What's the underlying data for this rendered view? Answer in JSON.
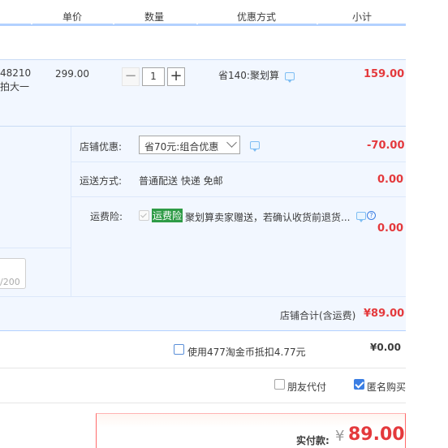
{
  "header": {
    "col_price": "单价",
    "col_qty": "数量",
    "col_promo": "优惠方式",
    "col_subtotal": "小计"
  },
  "item": {
    "id_fragment": "48210",
    "title_fragment": "拍大一",
    "price": "299.00",
    "quantity": "1",
    "promo": "省140:聚划算",
    "subtotal": "159.00"
  },
  "shop": {
    "discount_label": "店铺优惠:",
    "discount_selected": "省70元:组合优惠",
    "discount_amount": "-70.00",
    "shipping_label": "运送方式:",
    "shipping_value": "普通配送 快递 免邮",
    "shipping_amount": "0.00",
    "insurance_label": "运费险:",
    "insurance_tag": "运费险",
    "insurance_text": "聚划算卖家赠送，若确认收货前退货...",
    "insurance_amount": "0.00",
    "memo_counter": "/200",
    "total_label": "店铺合计(含运费)",
    "total_amount": "¥89.00"
  },
  "coin": {
    "label": "使用477淘金币抵扣4.77元",
    "amount": "¥0.00"
  },
  "options": {
    "friend_pay": "朋友代付",
    "anonymous": "匿名购买",
    "anonymous_checked": true,
    "friend_pay_checked": false
  },
  "pay": {
    "label": "实付款:",
    "currency": "¥",
    "amount": "89.00"
  },
  "colors": {
    "accent_red": "#e4393c",
    "header_blue": "#b2d1ff",
    "section_bg": "#f2f7ff",
    "tag_green": "#2e9b46"
  },
  "icons": [
    "message-icon",
    "help-icon",
    "chevron-down-icon",
    "checkbox-icon"
  ]
}
